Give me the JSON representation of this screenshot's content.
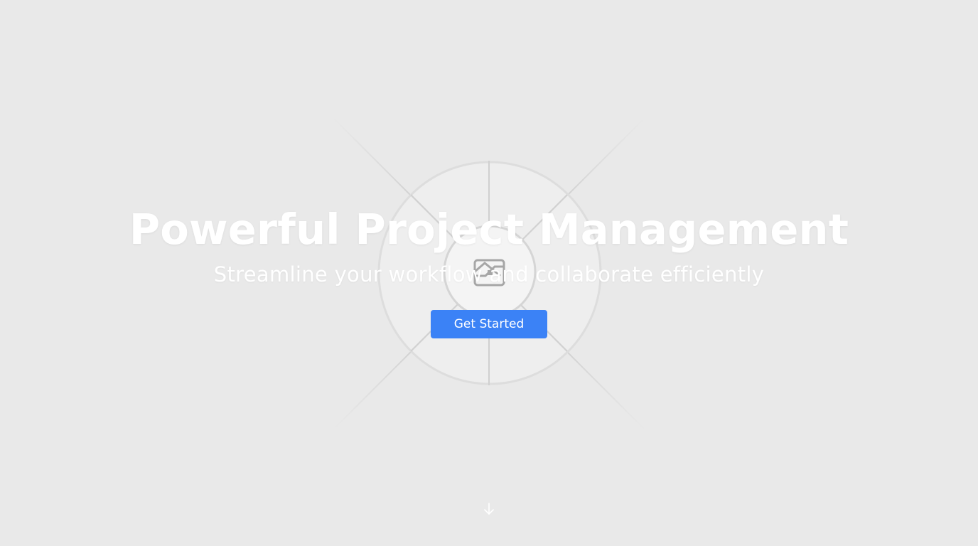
{
  "hero": {
    "title": "Powerful Project Management",
    "subtitle": "Streamline your workflow and collaborate efficiently",
    "cta_label": "Get Started",
    "background_image_icon": "image-placeholder-icon",
    "scroll_icon": "arrow-down-icon"
  },
  "colors": {
    "page_background": "#e9e9e9",
    "text": "#ffffff",
    "accent": "#3b82f6"
  }
}
